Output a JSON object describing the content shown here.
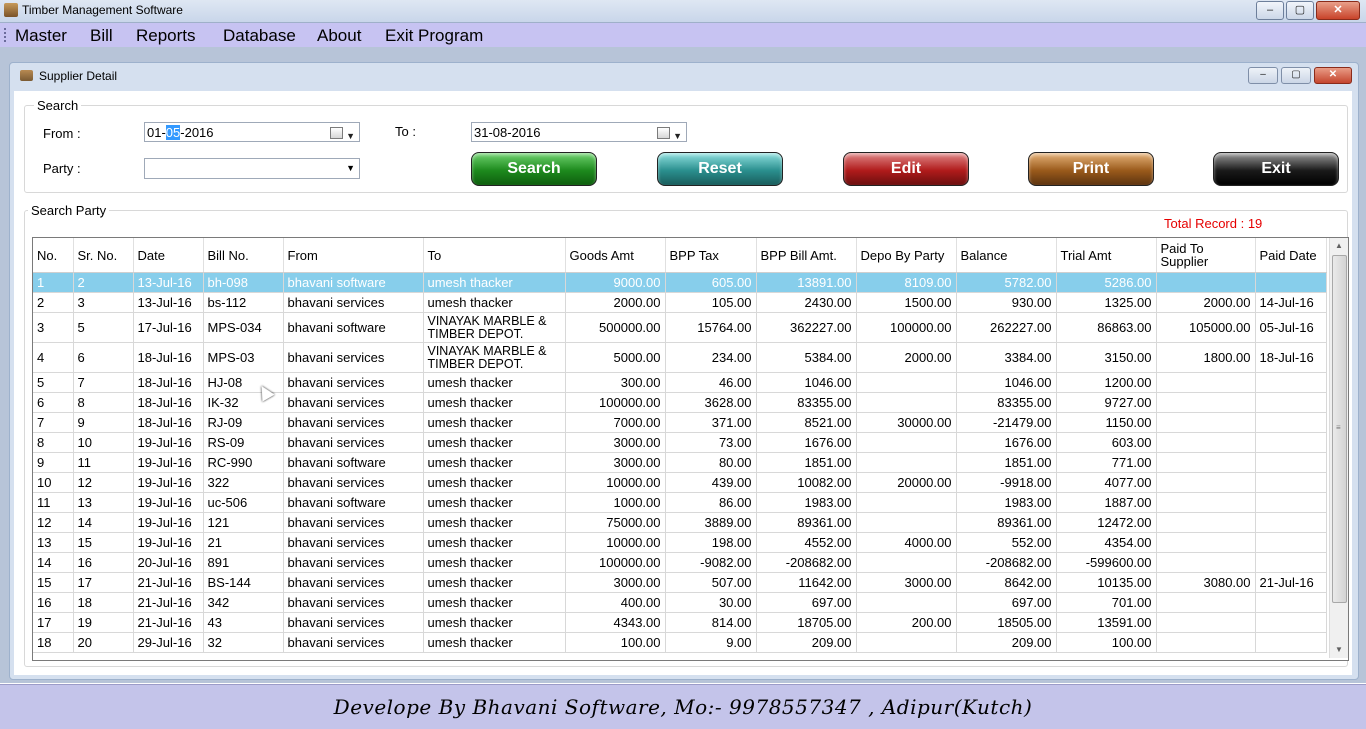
{
  "app": {
    "title": "Timber Management Software",
    "win_min": "–",
    "win_max": "▢",
    "win_close": "✕"
  },
  "menu": {
    "items": [
      "Master",
      "Bill",
      "Reports",
      "Database",
      "About",
      "Exit Program"
    ]
  },
  "window": {
    "title": "Supplier Detail",
    "min": "–",
    "max": "▢",
    "close": "✕"
  },
  "search": {
    "group_label": "Search",
    "from_label": "From :",
    "from_date_prefix": "01-",
    "from_date_highlight": "05",
    "from_date_suffix": "-2016",
    "to_label": "To :",
    "to_date": "31-08-2016",
    "party_label": "Party :",
    "party_value": ""
  },
  "buttons": {
    "search": "Search",
    "reset": "Reset",
    "edit": "Edit",
    "print": "Print",
    "exit": "Exit"
  },
  "results": {
    "group_label": "Search Party",
    "total_record": "Total Record : 19",
    "columns": [
      "No.",
      "Sr. No.",
      "Date",
      "Bill No.",
      "From",
      "To",
      "Goods Amt",
      "BPP Tax",
      "BPP Bill Amt.",
      "Depo By Party",
      "Balance",
      "Trial Amt",
      "Paid To Supplier",
      "Paid Date"
    ],
    "rows": [
      [
        "1",
        "2",
        "13-Jul-16",
        "bh-098",
        "bhavani software",
        "umesh thacker",
        "9000.00",
        "605.00",
        "13891.00",
        "8109.00",
        "5782.00",
        "5286.00",
        "",
        ""
      ],
      [
        "2",
        "3",
        "13-Jul-16",
        "bs-112",
        "bhavani services",
        "umesh thacker",
        "2000.00",
        "105.00",
        "2430.00",
        "1500.00",
        "930.00",
        "1325.00",
        "2000.00",
        "14-Jul-16"
      ],
      [
        "3",
        "5",
        "17-Jul-16",
        "MPS-034",
        "bhavani software",
        "VINAYAK MARBLE & TIMBER DEPOT.",
        "500000.00",
        "15764.00",
        "362227.00",
        "100000.00",
        "262227.00",
        "86863.00",
        "105000.00",
        "05-Jul-16"
      ],
      [
        "4",
        "6",
        "18-Jul-16",
        "MPS-03",
        "bhavani services",
        "VINAYAK MARBLE & TIMBER DEPOT.",
        "5000.00",
        "234.00",
        "5384.00",
        "2000.00",
        "3384.00",
        "3150.00",
        "1800.00",
        "18-Jul-16"
      ],
      [
        "5",
        "7",
        "18-Jul-16",
        "HJ-08",
        "bhavani services",
        "umesh thacker",
        "300.00",
        "46.00",
        "1046.00",
        "",
        "1046.00",
        "1200.00",
        "",
        ""
      ],
      [
        "6",
        "8",
        "18-Jul-16",
        "IK-32",
        "bhavani services",
        "umesh thacker",
        "100000.00",
        "3628.00",
        "83355.00",
        "",
        "83355.00",
        "9727.00",
        "",
        ""
      ],
      [
        "7",
        "9",
        "18-Jul-16",
        "RJ-09",
        "bhavani services",
        "umesh thacker",
        "7000.00",
        "371.00",
        "8521.00",
        "30000.00",
        "-21479.00",
        "1150.00",
        "",
        ""
      ],
      [
        "8",
        "10",
        "19-Jul-16",
        "RS-09",
        "bhavani services",
        "umesh thacker",
        "3000.00",
        "73.00",
        "1676.00",
        "",
        "1676.00",
        "603.00",
        "",
        ""
      ],
      [
        "9",
        "11",
        "19-Jul-16",
        "RC-990",
        "bhavani software",
        "umesh thacker",
        "3000.00",
        "80.00",
        "1851.00",
        "",
        "1851.00",
        "771.00",
        "",
        ""
      ],
      [
        "10",
        "12",
        "19-Jul-16",
        "322",
        "bhavani services",
        "umesh thacker",
        "10000.00",
        "439.00",
        "10082.00",
        "20000.00",
        "-9918.00",
        "4077.00",
        "",
        ""
      ],
      [
        "11",
        "13",
        "19-Jul-16",
        "uc-506",
        "bhavani software",
        "umesh thacker",
        "1000.00",
        "86.00",
        "1983.00",
        "",
        "1983.00",
        "1887.00",
        "",
        ""
      ],
      [
        "12",
        "14",
        "19-Jul-16",
        "121",
        "bhavani services",
        "umesh thacker",
        "75000.00",
        "3889.00",
        "89361.00",
        "",
        "89361.00",
        "12472.00",
        "",
        ""
      ],
      [
        "13",
        "15",
        "19-Jul-16",
        "21",
        "bhavani services",
        "umesh thacker",
        "10000.00",
        "198.00",
        "4552.00",
        "4000.00",
        "552.00",
        "4354.00",
        "",
        ""
      ],
      [
        "14",
        "16",
        "20-Jul-16",
        "891",
        "bhavani services",
        "umesh thacker",
        "100000.00",
        "-9082.00",
        "-208682.00",
        "",
        "-208682.00",
        "-599600.00",
        "",
        ""
      ],
      [
        "15",
        "17",
        "21-Jul-16",
        "BS-144",
        "bhavani services",
        "umesh thacker",
        "3000.00",
        "507.00",
        "11642.00",
        "3000.00",
        "8642.00",
        "10135.00",
        "3080.00",
        "21-Jul-16"
      ],
      [
        "16",
        "18",
        "21-Jul-16",
        "342",
        "bhavani services",
        "umesh thacker",
        "400.00",
        "30.00",
        "697.00",
        "",
        "697.00",
        "701.00",
        "",
        ""
      ],
      [
        "17",
        "19",
        "21-Jul-16",
        "43",
        "bhavani services",
        "umesh thacker",
        "4343.00",
        "814.00",
        "18705.00",
        "200.00",
        "18505.00",
        "13591.00",
        "",
        ""
      ],
      [
        "18",
        "20",
        "29-Jul-16",
        "32",
        "bhavani services",
        "umesh thacker",
        "100.00",
        "9.00",
        "209.00",
        "",
        "209.00",
        "100.00",
        "",
        ""
      ]
    ]
  },
  "footer": {
    "text": "Develope By Bhavani Software, Mo:- 9978557347 , Adipur(Kutch)"
  }
}
